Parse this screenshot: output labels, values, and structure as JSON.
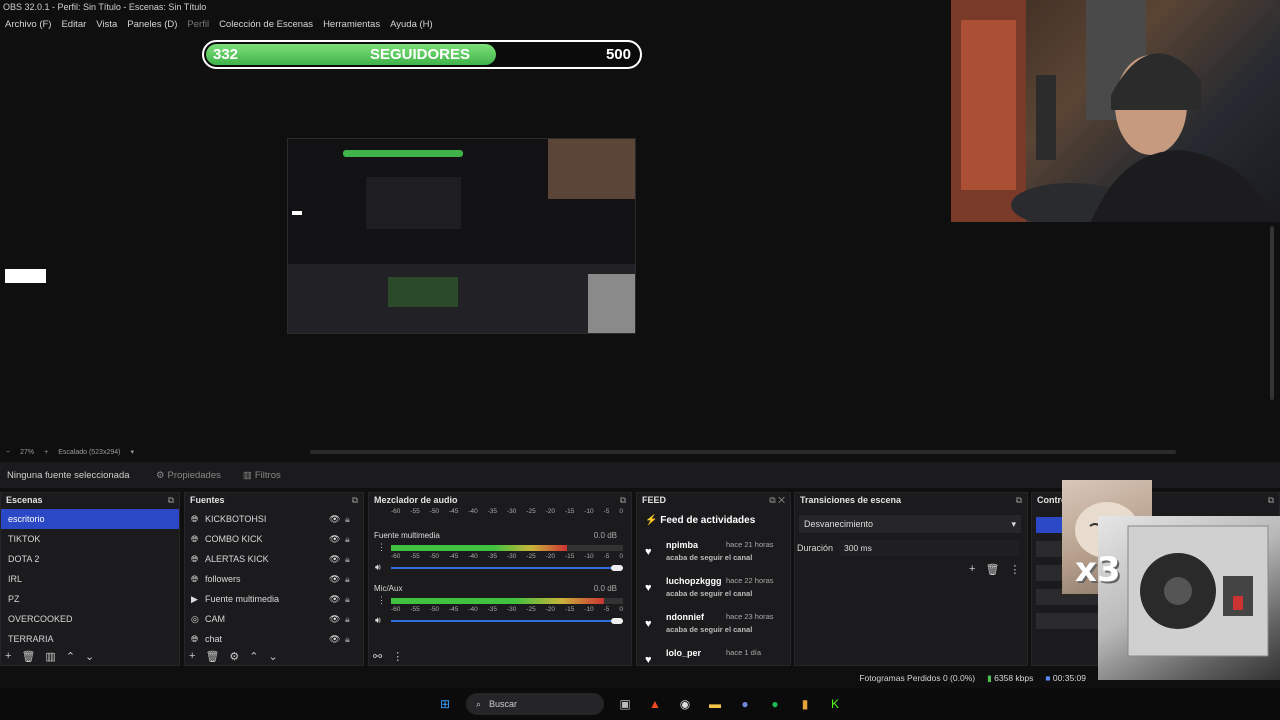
{
  "window": {
    "title": "OBS 32.0.1 - Perfil: Sin Título - Escenas: Sin Título"
  },
  "menu": [
    {
      "label": "Archivo (F)",
      "enabled": true
    },
    {
      "label": "Editar",
      "enabled": true
    },
    {
      "label": "Vista",
      "enabled": true
    },
    {
      "label": "Paneles (D)",
      "enabled": true
    },
    {
      "label": "Perfil",
      "enabled": false
    },
    {
      "label": "Colección de Escenas",
      "enabled": true
    },
    {
      "label": "Herramientas",
      "enabled": true
    },
    {
      "label": "Ayuda (H)",
      "enabled": true
    }
  ],
  "followers_goal": {
    "current": "332",
    "label": "SEGUIDORES",
    "target": "500",
    "fill_fraction": 0.664,
    "color": "#4cc152"
  },
  "zoom": {
    "minus": "−",
    "value": "27%",
    "plus": "+",
    "mode": "Escalado (523x294)"
  },
  "props_bar": {
    "no_source": "Ninguna fuente seleccionada",
    "properties": "Propiedades",
    "filters": "Filtros"
  },
  "scenes": {
    "title": "Escenas",
    "items": [
      "escritorio",
      "TIKTOK",
      "DOTA 2",
      "IRL",
      "PZ",
      "OVERCOOKED",
      "TERRARIA"
    ],
    "selected_index": 0
  },
  "sources": {
    "title": "Fuentes",
    "items": [
      {
        "name": "KICKBOTOHSI",
        "icon": "globe-icon"
      },
      {
        "name": "COMBO KICK",
        "icon": "globe-icon"
      },
      {
        "name": "ALERTAS KICK",
        "icon": "globe-icon"
      },
      {
        "name": "followers",
        "icon": "globe-icon"
      },
      {
        "name": "Fuente multimedia",
        "icon": "play-icon"
      },
      {
        "name": "CAM",
        "icon": "camera-icon"
      },
      {
        "name": "chat",
        "icon": "globe-icon"
      }
    ]
  },
  "mixer": {
    "title": "Mezclador de audio",
    "scale": [
      "-60",
      "-55",
      "-50",
      "-45",
      "-40",
      "-35",
      "-30",
      "-25",
      "-20",
      "-15",
      "-10",
      "-5",
      "0"
    ],
    "channels": [
      {
        "name": "Fuente multimedia",
        "db": "0.0 dB",
        "level": 0.76
      },
      {
        "name": "Mic/Aux",
        "db": "0.0 dB",
        "level": 0.92
      }
    ]
  },
  "feed": {
    "title": "FEED",
    "heading": "Feed de actividades",
    "items": [
      {
        "name": "npimba",
        "time": "hace 21 horas",
        "desc": "acaba de seguir el canal"
      },
      {
        "name": "luchopzkggg",
        "time": "hace 22 horas",
        "desc": "acaba de seguir el canal"
      },
      {
        "name": "ndonnief",
        "time": "hace 23 horas",
        "desc": "acaba de seguir el canal"
      },
      {
        "name": "lolo_per",
        "time": "hace 1 día",
        "desc": ""
      }
    ]
  },
  "transitions": {
    "title": "Transiciones de escena",
    "selected": "Desvanecimiento",
    "duration_label": "Duración",
    "duration_value": "300 ms"
  },
  "controls": {
    "title": "Contro"
  },
  "overlay": {
    "combo_text": "x3"
  },
  "status": {
    "dropped": "Fotogramas Perdidos 0 (0.0%)",
    "bitrate": "6358 kbps",
    "time": "00:35:09"
  },
  "taskbar": {
    "search": "Buscar"
  }
}
